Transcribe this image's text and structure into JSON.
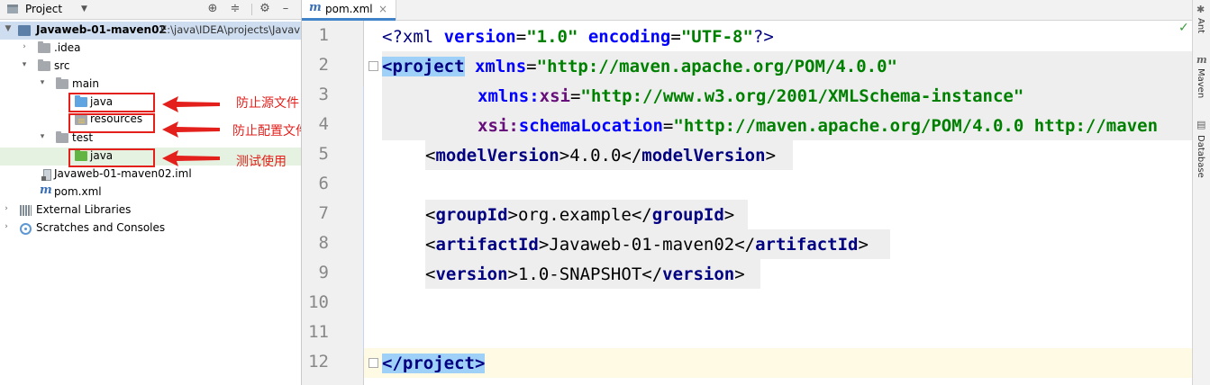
{
  "project_panel": {
    "title": "Project",
    "tree": {
      "root_name": "Javaweb-01-maven02",
      "root_path": "E:\\java\\IDEA\\projects\\Javav",
      "idea": ".idea",
      "src": "src",
      "main": "main",
      "main_java": "java",
      "resources": "resources",
      "test": "test",
      "test_java": "java",
      "iml": "Javaweb-01-maven02.iml",
      "pom": "pom.xml",
      "external_libraries": "External Libraries",
      "scratches": "Scratches and Consoles"
    },
    "icons": [
      "target-icon",
      "collapse-icon",
      "gear-icon",
      "minimize-icon"
    ]
  },
  "annotations": {
    "source": "防止源文件",
    "config": "防止配置文件",
    "test": "测试使用",
    "color": "#e3201c"
  },
  "editor": {
    "tab_label": "pom.xml",
    "line_numbers": [
      "1",
      "2",
      "3",
      "4",
      "5",
      "6",
      "7",
      "8",
      "9",
      "10",
      "11",
      "12"
    ],
    "xml_decl": {
      "open": "<?xml",
      "version_attr": "version",
      "version_val": "\"1.0\"",
      "encoding_attr": "encoding",
      "encoding_val": "\"UTF-8\"",
      "close": "?>"
    },
    "project_open": "<project",
    "xmlns_attr": "xmlns",
    "xmlns_val": "\"http://maven.apache.org/POM/4.0.0\"",
    "xmlns_xsi_prefix": "xmlns:",
    "xmlns_xsi_name": "xsi",
    "xmlns_xsi_val": "\"http://www.w3.org/2001/XMLSchema-instance\"",
    "schema_prefix": "xsi:",
    "schema_name": "schemaLocation",
    "schema_val": "\"http://maven.apache.org/POM/4.0.0 http://maven",
    "model_version": {
      "tag": "modelVersion",
      "value": "4.0.0"
    },
    "group_id": {
      "tag": "groupId",
      "value": "org.example"
    },
    "artifact_id": {
      "tag": "artifactId",
      "value": "Javaweb-01-maven02"
    },
    "version": {
      "tag": "version",
      "value": "1.0-SNAPSHOT"
    },
    "project_close": "</project>"
  },
  "right_strip": {
    "ant": "Ant",
    "maven": "Maven",
    "database": "Database"
  }
}
